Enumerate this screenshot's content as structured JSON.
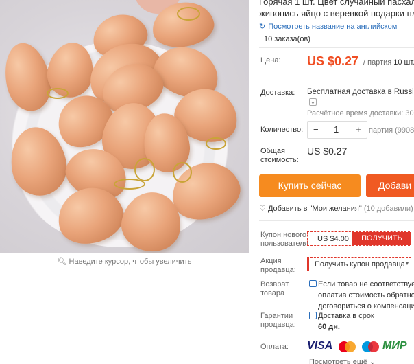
{
  "product": {
    "title_line1": "Горячая 1 шт. Цвет случайный пасхаль",
    "title_line2": "живопись яйцо с веревкой подарки пл",
    "translate_link": "Посмотреть название на английском",
    "orders": "10 заказа(ов)",
    "zoom_hint": "Наведите курсор, чтобы увеличить"
  },
  "price": {
    "label": "Цена:",
    "value": "US $0.27",
    "lot_prefix": "/ партия",
    "lot_count": "10 шт."
  },
  "shipping": {
    "label": "Доставка:",
    "value": "Бесплатная доставка в Russian",
    "eta": "Расчётное время доставки: 30-5"
  },
  "quantity": {
    "label": "Количество:",
    "minus": "−",
    "value": "1",
    "plus": "+",
    "available": "партия (9908 п"
  },
  "total": {
    "label_line1": "Общая",
    "label_line2": "стоимость:",
    "value": "US $0.27"
  },
  "actions": {
    "buy_now": "Купить сейчас",
    "add_to_cart": "Добави"
  },
  "wishlist": {
    "label": "Добавить в \"Мои желания\"",
    "count": "(10 добавили)"
  },
  "coupons": {
    "new_user_label_line1": "Купон нового",
    "new_user_label_line2": "пользователя",
    "new_user_amount": "US $4.00",
    "new_user_button": "ПОЛУЧИТЬ",
    "seller_label_line1": "Акция",
    "seller_label_line2": "продавца:",
    "seller_button": "Получить купон продавца"
  },
  "returns": {
    "label_line1": "Возврат",
    "label_line2": "товара",
    "line1": "Если товар не соответствует",
    "line2": "оплатив стоимость обратной",
    "line3": "договориться о компенсаци"
  },
  "guarantee": {
    "label_line1": "Гарантии",
    "label_line2": "продавца:",
    "line1": "Доставка в срок",
    "line2": "60 дн."
  },
  "payment": {
    "label": "Оплата:",
    "visa": "VISA",
    "mir": "МИР",
    "more": "Посмотреть ещё",
    "icons": [
      "visa-logo",
      "mastercard-logo",
      "maestro-logo",
      "mir-logo"
    ]
  },
  "colors": {
    "price": "#f04e23",
    "buy_button": "#f68b1f",
    "cart_button": "#f05a22",
    "coupon": "#e0362b",
    "link": "#2a6ebb"
  }
}
